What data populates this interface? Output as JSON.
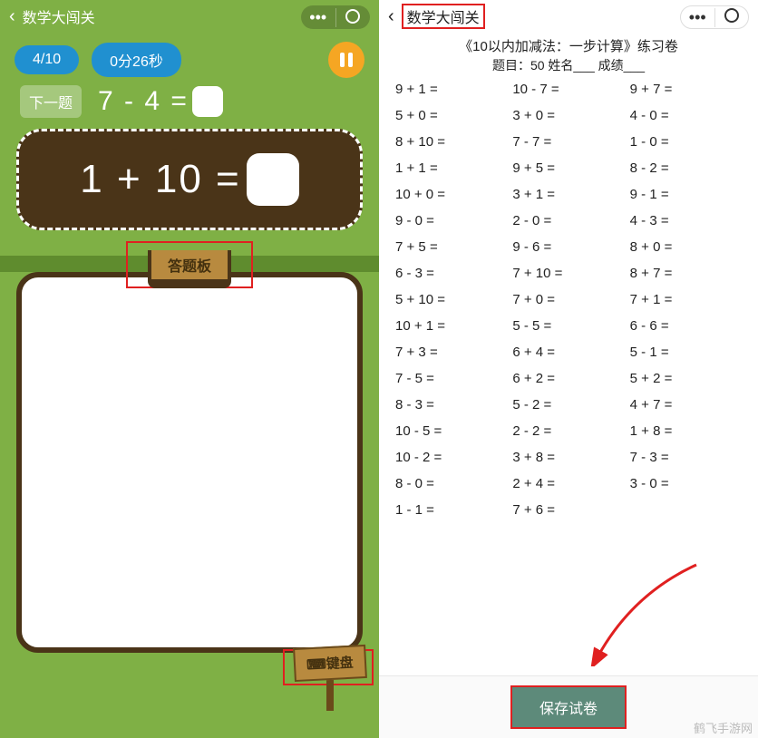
{
  "app_title": "数学大闯关",
  "left": {
    "progress": "4/10",
    "timer": "0分26秒",
    "next_label": "下一题",
    "next_equation": "7 - 4 =",
    "main_equation": "1 + 10 =",
    "board_tab": "答题板",
    "keyboard_label": "键盘"
  },
  "right": {
    "sheet_title": "《10以内加减法：一步计算》练习卷",
    "sheet_sub": "题目：50 姓名___ 成绩___",
    "save_button": "保存试卷",
    "problems_col1": [
      "9 + 1 =",
      "5 + 0 =",
      "8 + 10 =",
      "1 + 1 =",
      "10 + 0 =",
      "9 - 0 =",
      "7 + 5 =",
      "6 - 3 =",
      "5 + 10 =",
      "10 + 1 =",
      "7 + 3 =",
      "7 - 5 =",
      "8 - 3 =",
      "10 - 5 =",
      "10 - 2 =",
      "8 - 0 =",
      "1 - 1 ="
    ],
    "problems_col2": [
      "10 - 7 =",
      "3 + 0 =",
      "7 - 7 =",
      "9 + 5 =",
      "3 + 1 =",
      "2 - 0 =",
      "9 - 6 =",
      "7 + 10 =",
      "7 + 0 =",
      "5 - 5 =",
      "6 + 4 =",
      "6 + 2 =",
      "5 - 2 =",
      "2 - 2 =",
      "3 + 8 =",
      "2 + 4 =",
      "7 + 6 ="
    ],
    "problems_col3": [
      "9 + 7 =",
      "4 - 0 =",
      "1 - 0 =",
      "8 - 2 =",
      "9 - 1 =",
      "4 - 3 =",
      "8 + 0 =",
      "8 + 7 =",
      "7 + 1 =",
      "6 - 6 =",
      "5 - 1 =",
      "5 + 2 =",
      "4 + 7 =",
      "1 + 8 =",
      "7 - 3 =",
      "3 - 0 ="
    ]
  },
  "watermark": "鹤飞手游网"
}
